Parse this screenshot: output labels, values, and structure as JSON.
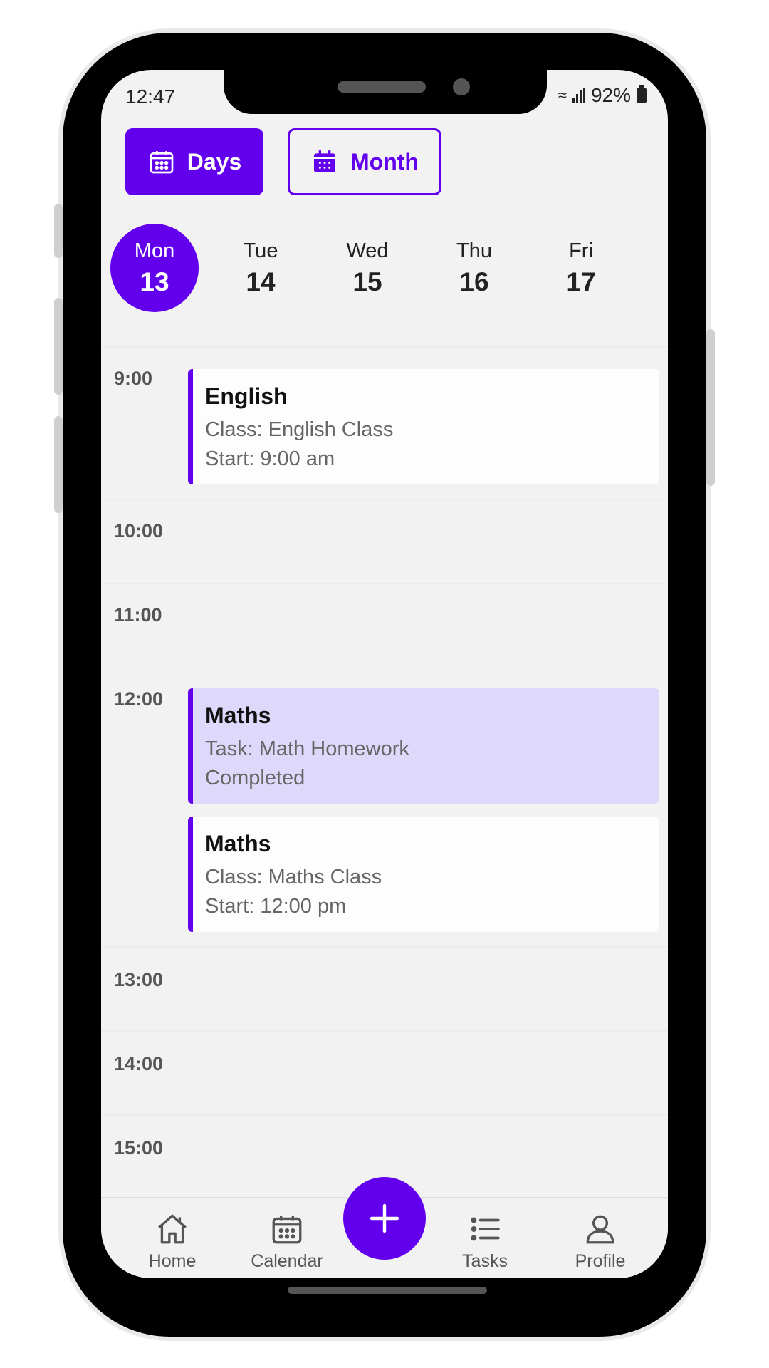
{
  "status_bar": {
    "time": "12:47",
    "battery": "92%"
  },
  "view_toggle": {
    "days_label": "Days",
    "month_label": "Month"
  },
  "days": [
    {
      "name": "Mon",
      "num": "13",
      "selected": true
    },
    {
      "name": "Tue",
      "num": "14"
    },
    {
      "name": "Wed",
      "num": "15"
    },
    {
      "name": "Thu",
      "num": "16"
    },
    {
      "name": "Fri",
      "num": "17"
    }
  ],
  "hours": [
    "9:00",
    "10:00",
    "11:00",
    "12:00",
    "13:00",
    "14:00",
    "15:00"
  ],
  "events": [
    {
      "title": "English",
      "line1": "Class: English Class",
      "line2": "Start: 9:00 am",
      "completed": false
    },
    {
      "title": "Maths",
      "line1": "Task: Math Homework",
      "line2": "Completed",
      "completed": true
    },
    {
      "title": "Maths",
      "line1": "Class: Maths Class",
      "line2": "Start: 12:00 pm",
      "completed": false
    }
  ],
  "bottom_nav": {
    "home": "Home",
    "calendar": "Calendar",
    "tasks": "Tasks",
    "profile": "Profile",
    "add_icon": "plus-icon"
  },
  "colors": {
    "accent": "#6200ee",
    "completed_bg": "#ded8fa"
  }
}
